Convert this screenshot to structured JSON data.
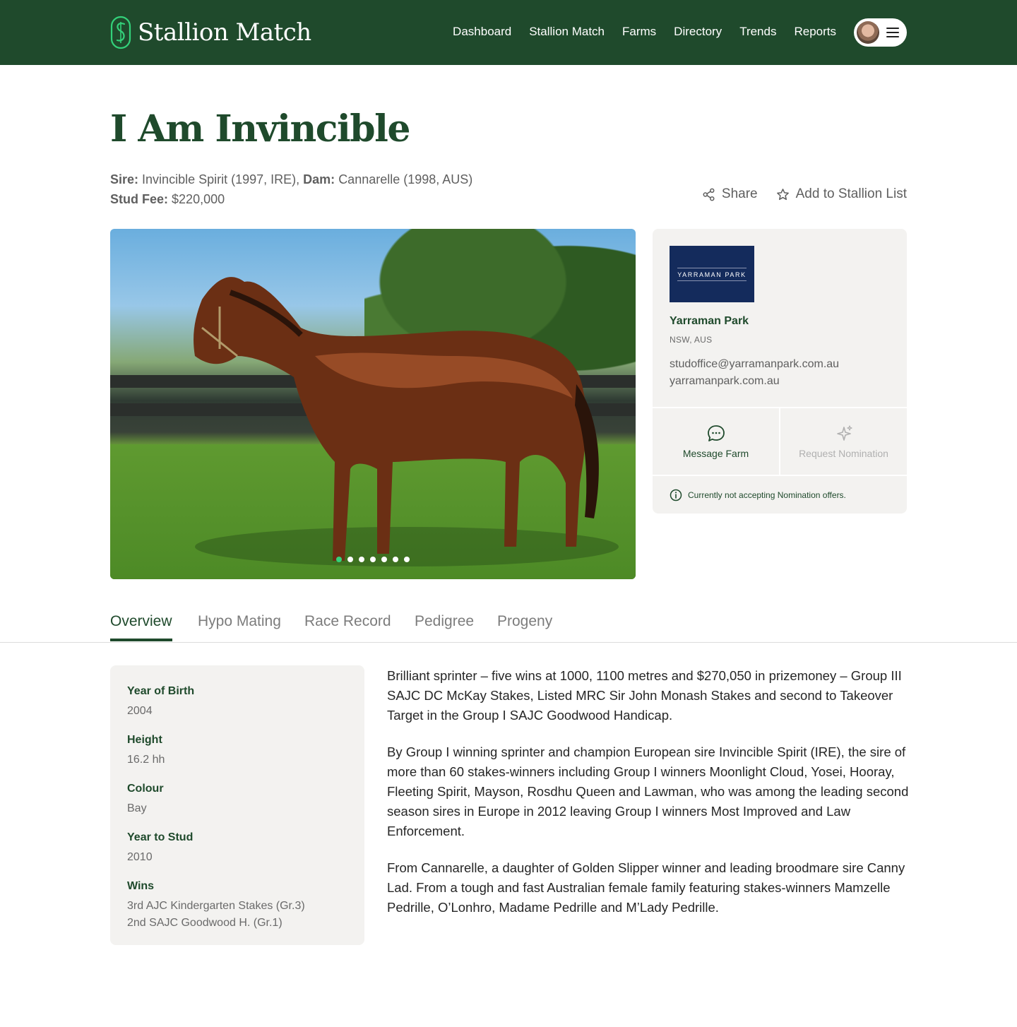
{
  "app": {
    "name": "Stallion Match",
    "nav": [
      "Dashboard",
      "Stallion Match",
      "Farms",
      "Directory",
      "Trends",
      "Reports"
    ]
  },
  "stallion": {
    "name": "I Am Invincible",
    "sire_label": "Sire:",
    "sire": "Invincible Spirit (1997, IRE),",
    "dam_label": "Dam:",
    "dam": "Cannarelle (1998, AUS)",
    "fee_label": "Stud Fee:",
    "fee": "$220,000"
  },
  "actions": {
    "share": "Share",
    "add_to_list": "Add to Stallion List"
  },
  "gallery": {
    "slide_count": 7,
    "active_index": 0
  },
  "farm": {
    "logo_text": "YARRAMAN PARK",
    "name": "Yarraman Park",
    "location": "NSW, AUS",
    "email": "studoffice@yarramanpark.com.au",
    "website": "yarramanpark.com.au",
    "message_label": "Message Farm",
    "request_label": "Request Nomination",
    "note": "Currently not accepting Nomination offers."
  },
  "tabs": [
    "Overview",
    "Hypo Mating",
    "Race Record",
    "Pedigree",
    "Progeny"
  ],
  "overview": {
    "items": [
      {
        "label": "Year of Birth",
        "value": "2004"
      },
      {
        "label": "Height",
        "value": "16.2 hh"
      },
      {
        "label": "Colour",
        "value": "Bay"
      },
      {
        "label": "Year to Stud",
        "value": "2010"
      },
      {
        "label": "Wins",
        "value": "3rd AJC Kindergarten Stakes (Gr.3)",
        "value2": "2nd SAJC Goodwood H. (Gr.1)"
      }
    ],
    "description": [
      "Brilliant sprinter – five wins at 1000, 1100 metres and $270,050 in prizemoney – Group III SAJC DC McKay Stakes, Listed MRC Sir John Monash Stakes and second to Takeover Target in the Group I SAJC Goodwood Handicap.",
      "By Group I winning sprinter and champion European sire Invincible Spirit (IRE), the sire of more than 60 stakes-winners including Group I winners Moonlight Cloud, Yosei, Hooray, Fleeting Spirit, Mayson, Rosdhu Queen and Lawman, who was among the leading second season sires in Europe in 2012 leaving Group I winners Most Improved and Law Enforcement.",
      "From Cannarelle, a daughter of Golden Slipper winner and leading broodmare sire Canny Lad. From a tough and fast Australian female family featuring stakes-winners Mamzelle Pedrille, O’Lonhro, Madame Pedrille and M’Lady Pedrille."
    ]
  },
  "colors": {
    "brand_green": "#1f4a2c",
    "accent_mint": "#33d17a",
    "card_bg": "#f3f2f0",
    "farm_logo_navy": "#142b5c"
  },
  "icons": [
    "stallion-match-logo-icon",
    "menu-icon",
    "share-icon",
    "star-icon",
    "chat-icon",
    "sparkle-icon",
    "info-icon"
  ]
}
